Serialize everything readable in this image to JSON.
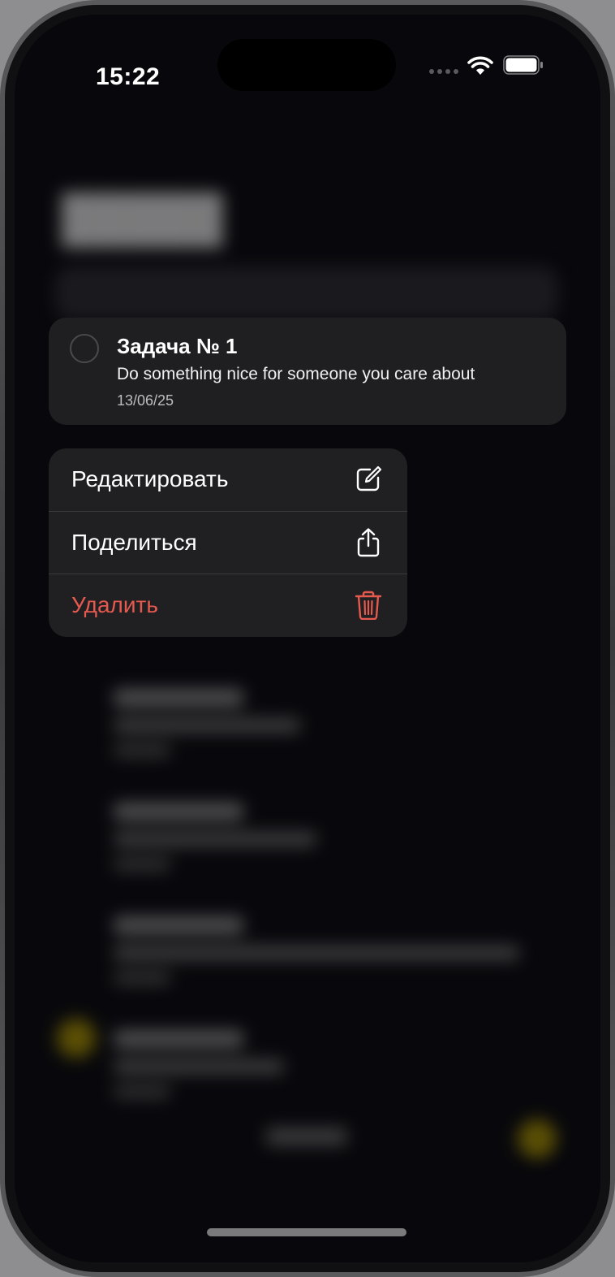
{
  "status_bar": {
    "time": "15:22"
  },
  "focused_task": {
    "title": "Задача № 1",
    "description": "Do something nice for someone you care about",
    "date": "13/06/25"
  },
  "context_menu": {
    "items": [
      {
        "label": "Редактировать",
        "icon": "edit-icon",
        "destructive": false
      },
      {
        "label": "Поделиться",
        "icon": "share-icon",
        "destructive": false
      },
      {
        "label": "Удалить",
        "icon": "trash-icon",
        "destructive": true
      }
    ]
  },
  "colors": {
    "background": "#08080c",
    "card": "#1f1f21",
    "destructive": "#e5594f",
    "accent_yellow": "#a08a00"
  }
}
